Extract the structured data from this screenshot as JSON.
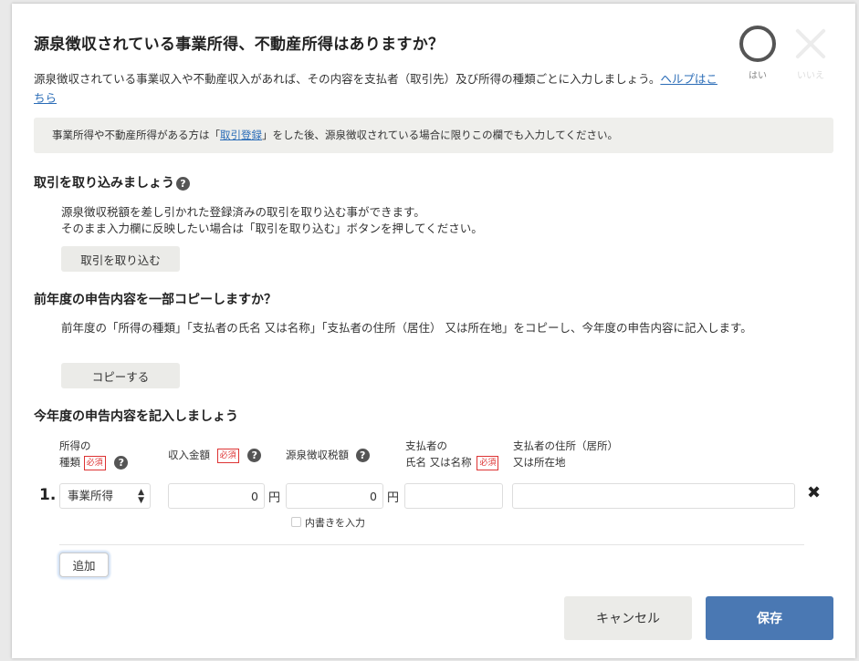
{
  "dialog": {
    "title": "源泉徴収されている事業所得、不動産所得はありますか？",
    "description": "源泉徴収されている事業収入や不動産収入があれば、その内容を支払者（取引先）及び所得の種類ごとに入力しましょう。",
    "help_link": "ヘルプはこちら",
    "yes_label": "はい",
    "no_label": "いいえ"
  },
  "notice": {
    "before": "事業所得や不動産所得がある方は「",
    "link": "取引登録",
    "after": "」をした後、源泉徴収されている場合に限りこの欄でも入力してください。"
  },
  "import_section": {
    "heading": "取引を取り込みましょう",
    "line1": "源泉徴収税額を差し引かれた登録済みの取引を取り込む事ができます。",
    "line2": "そのまま入力欄に反映したい場合は「取引を取り込む」ボタンを押してください。",
    "button": "取引を取り込む"
  },
  "copy_section": {
    "heading": "前年度の申告内容を一部コピーしますか？",
    "text": "前年度の「所得の種類」「支払者の氏名 又は名称」「支払者の住所（居住） 又は所在地」をコピーし、今年度の申告内容に記入します。",
    "button": "コピーする"
  },
  "entry_section": {
    "heading": "今年度の申告内容を記入しましょう",
    "required": "必須",
    "columns": {
      "type_line1": "所得の",
      "type_line2": "種類",
      "income": "収入金額",
      "withholding": "源泉徴収税額",
      "payer_name_line1": "支払者の",
      "payer_name_line2": "氏名 又は名称",
      "payer_address_line1": "支払者の住所（居所）",
      "payer_address_line2": "又は所在地"
    },
    "rows": [
      {
        "number": "1.",
        "type": "事業所得",
        "income": "0",
        "withholding": "0",
        "payer_name": "",
        "payer_address": ""
      }
    ],
    "yen": "円",
    "breakdown_label": "内書きを入力",
    "add_button": "追加"
  },
  "footer": {
    "cancel": "キャンセル",
    "save": "保存"
  }
}
